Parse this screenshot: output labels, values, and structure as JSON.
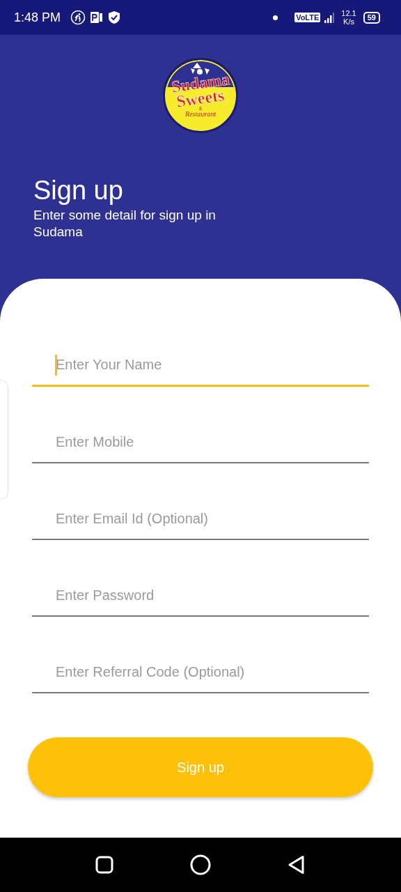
{
  "status_bar": {
    "time": "1:48 PM",
    "network_badge": "VoLTE",
    "speed": "12.1",
    "speed_unit": "K/s",
    "battery": "59"
  },
  "logo": {
    "line_1": "Sudama",
    "line_2": "Sweets",
    "ampersand": "&",
    "line_3": "Restaurant"
  },
  "header": {
    "title": "Sign up",
    "subtitle": "Enter some detail for sign up in Sudama"
  },
  "fields": [
    {
      "placeholder": "Enter Your Name",
      "focused": true
    },
    {
      "placeholder": "Enter Mobile",
      "focused": false
    },
    {
      "placeholder": "Enter Email Id (Optional)",
      "focused": false
    },
    {
      "placeholder": "Enter Password",
      "focused": false
    },
    {
      "placeholder": "Enter Referral Code (Optional)",
      "focused": false
    }
  ],
  "submit_button": "Sign up"
}
